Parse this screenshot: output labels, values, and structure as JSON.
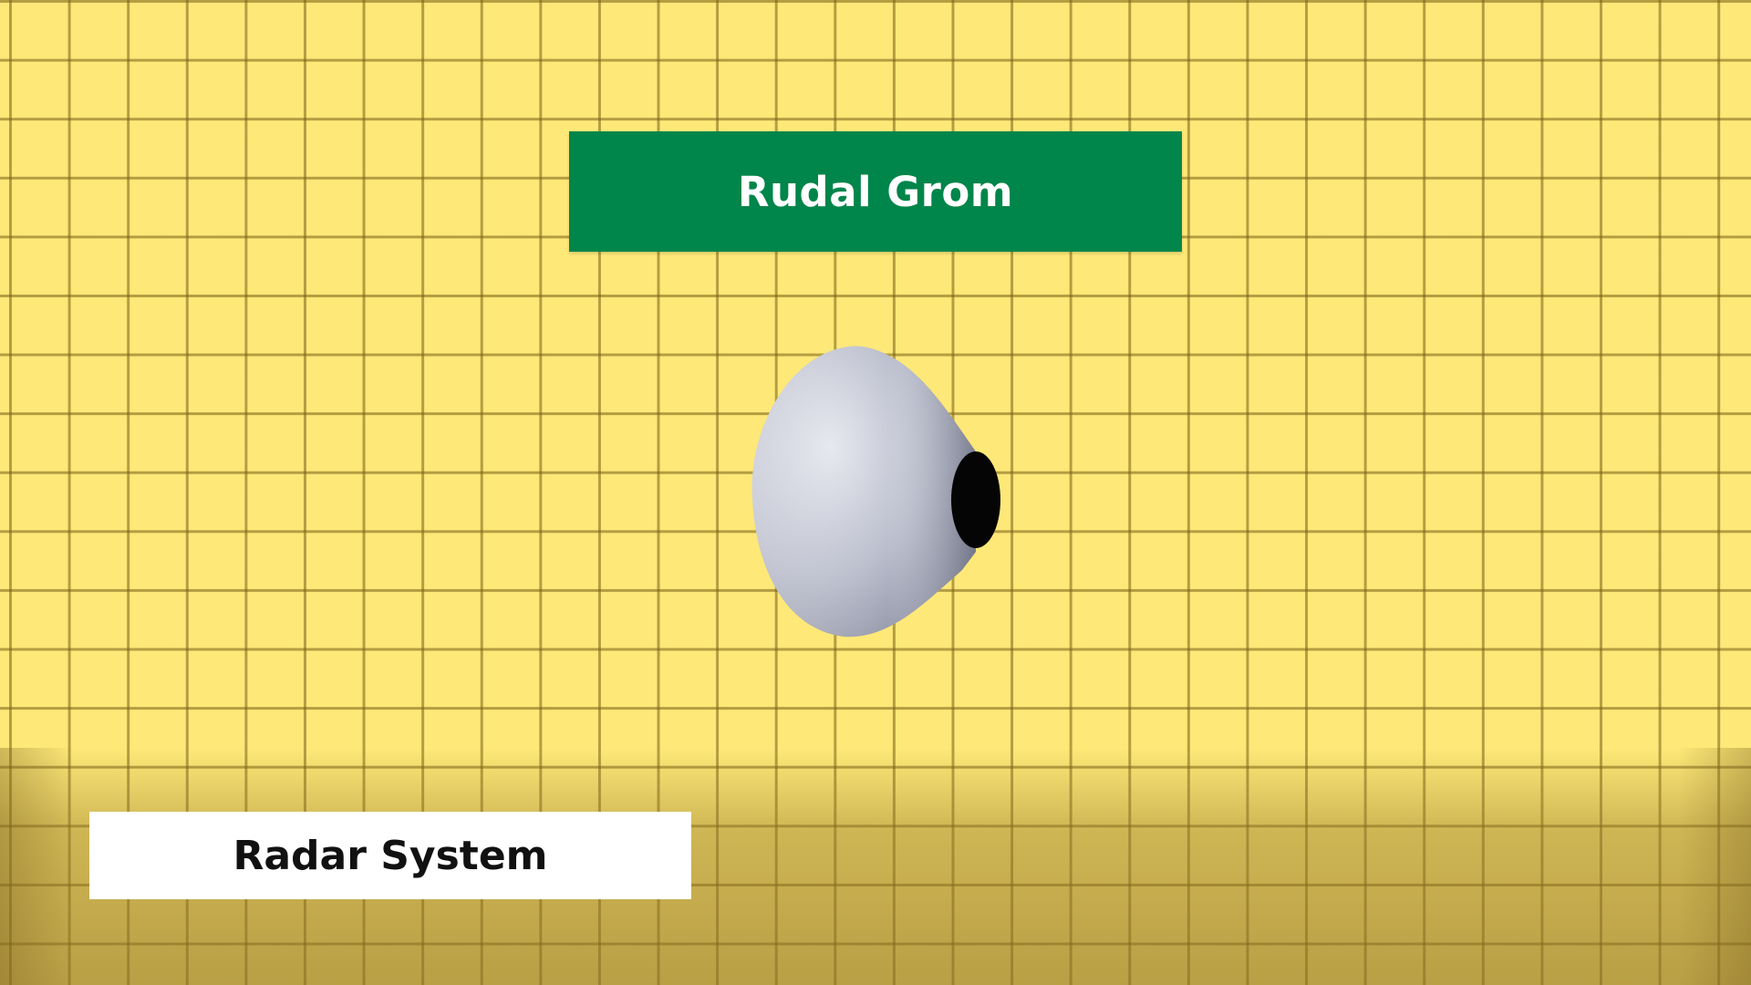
{
  "scene": {
    "background_color": "#fde878",
    "grid_line_color": "#7a6018"
  },
  "title_banner": {
    "text": "Rudal Grom",
    "background_color": "#00854a",
    "text_color": "#ffffff"
  },
  "object": {
    "name": "radar-dish-model",
    "body_color": "#c8cad6",
    "aperture_color": "#000000"
  },
  "label": {
    "text": "Radar System",
    "background_color": "#ffffff",
    "text_color": "#111111"
  }
}
